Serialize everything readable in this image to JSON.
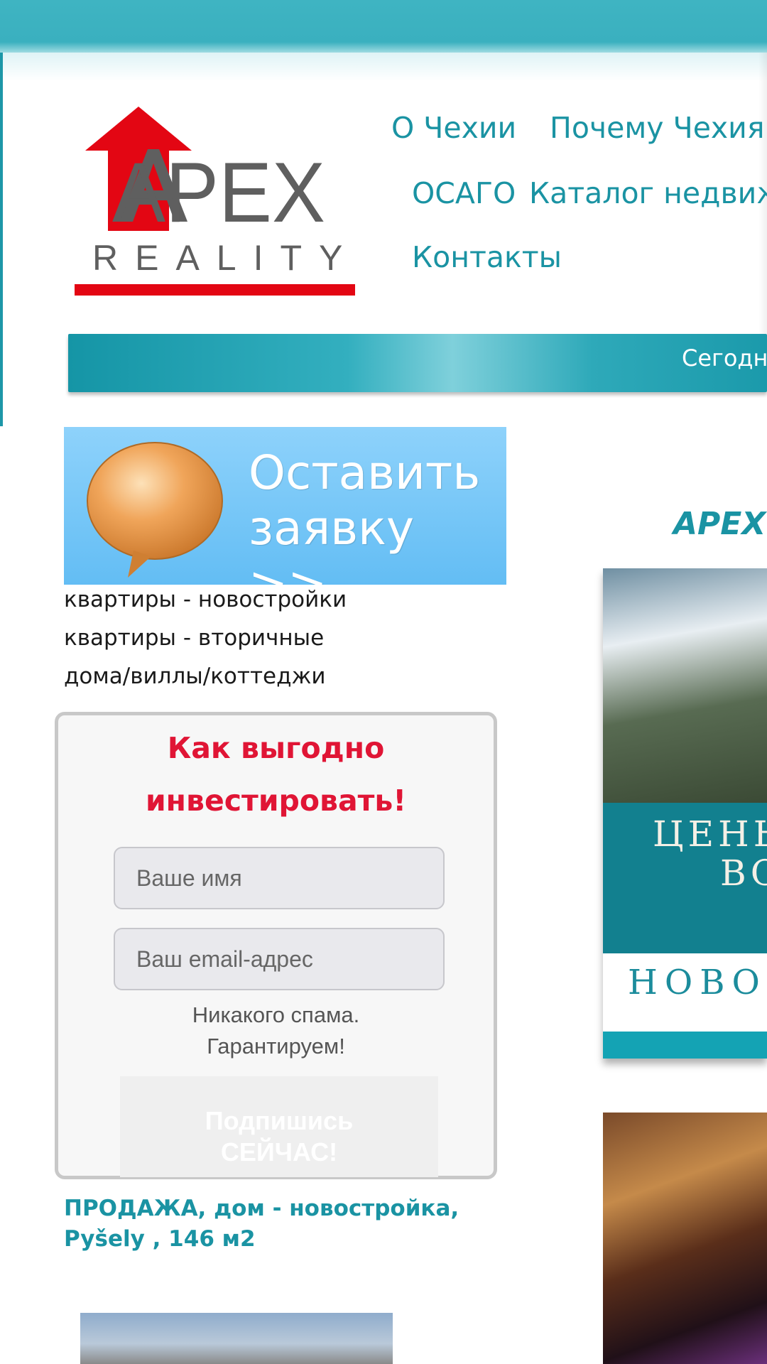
{
  "logo": {
    "word": "APEX",
    "sub": "REALITY"
  },
  "nav": {
    "items": [
      {
        "label": "О Чехии"
      },
      {
        "label": "Почему Чехия"
      },
      {
        "label": "ОСАГО"
      },
      {
        "label": "Каталог недвиж"
      },
      {
        "label": "Контакты"
      }
    ]
  },
  "strip": {
    "text": "Сегодн"
  },
  "request_banner": {
    "line1": "Оставить",
    "line2": "заявку >>"
  },
  "categories": [
    {
      "label": "квартиры - новостройки"
    },
    {
      "label": "квартиры - вторичные"
    },
    {
      "label": "дома/виллы/коттеджи"
    }
  ],
  "subscribe": {
    "title_line1": "Как выгодно",
    "title_line2": "инвестировать!",
    "name_placeholder": "Ваше имя",
    "email_placeholder": "Ваш email-адрес",
    "note_line1": "Никакого спама.",
    "note_line2": "Гарантируем!",
    "button_line1": "Подпишись",
    "button_line2": "СЕЙЧАС!"
  },
  "listing": {
    "title": "ПРОДАЖА, дом - новостройка, Pyšely , 146 м2"
  },
  "right": {
    "heading": "APEX",
    "promo_line1": "ЦЕНЫ",
    "promo_line2": "ВО",
    "promo_line3": "НОВО"
  },
  "colors": {
    "accent": "#1a93a3",
    "topbar": "#3ab0bf",
    "title_red": "#e01535",
    "logo_red": "#e30613",
    "logo_gray": "#5f5f5f"
  }
}
